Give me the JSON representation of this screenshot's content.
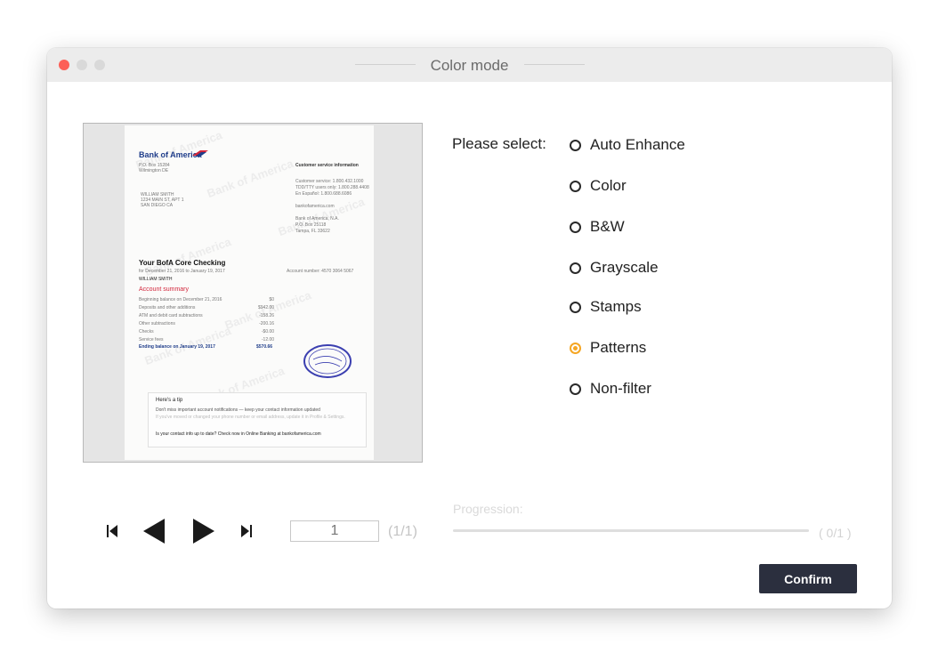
{
  "window": {
    "title": "Color mode"
  },
  "document": {
    "bank_name": "Bank of America",
    "heading": "Your BofA Core Checking",
    "account_summary": "Account summary",
    "tip_title": "Here's a tip",
    "tip_text": "Don't miss important account notifications — keep your contact information updated",
    "tip_question": "Is your contact info up to date? Check now in Online Banking at bankofamerica.com",
    "ending_balance": "Ending balance on January 19, 2017",
    "ending_amount": "$570.66",
    "customer_info": "Customer service information",
    "account_number": "Account number: 4570 3064 5067",
    "owner": "WILLIAM SMITH"
  },
  "controls": {
    "page_value": "1",
    "page_count": "(1/1)"
  },
  "select": {
    "label": "Please select:",
    "options": [
      {
        "label": "Auto Enhance",
        "selected": false
      },
      {
        "label": "Color",
        "selected": false
      },
      {
        "label": "B&W",
        "selected": false
      },
      {
        "label": "Grayscale",
        "selected": false
      },
      {
        "label": "Stamps",
        "selected": false
      },
      {
        "label": "Patterns",
        "selected": true
      },
      {
        "label": "Non-filter",
        "selected": false
      }
    ]
  },
  "progress": {
    "label": "Progression:",
    "value": 0,
    "count": "( 0/1 )"
  },
  "confirm_label": "Confirm",
  "colors": {
    "accent": "#f5a623",
    "button": "#2b2f3e",
    "close": "#fc5f57"
  }
}
